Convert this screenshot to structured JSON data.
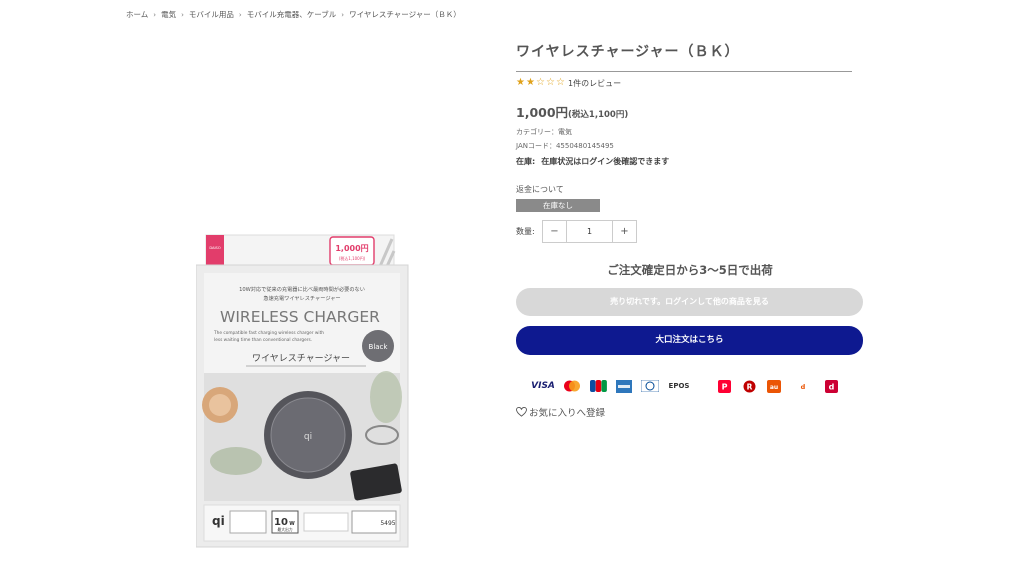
{
  "breadcrumb": [
    "ホーム",
    "電気",
    "モバイル用品",
    "モバイル充電器、ケーブル",
    "ワイヤレスチャージャー（ＢＫ）"
  ],
  "product": {
    "title": "ワイヤレスチャージャー（ＢＫ）",
    "rating_value": 2,
    "rating_max": 5,
    "review_text": "1件のレビュー",
    "price": "1,000円",
    "price_tax": "(税込1,100円)",
    "category": "カテゴリー：電気",
    "jan": "JANコード：4550480145495",
    "stock_label": "在庫:",
    "stock_value": "在庫状況はログイン後確認できます",
    "refund_link": "返金について",
    "soldout_badge": "在庫なし",
    "qty_label": "数量:",
    "qty_value": "1",
    "ship_note": "ご注文確定日から3〜5日で出荷",
    "soldout_button": "売り切れです。ログインして他の商品を見る",
    "bulk_button": "大口注文はこちら",
    "favorite": "お気に入りへ登録"
  },
  "package": {
    "brand": "DAISO",
    "price": "1,000円",
    "price_tax": "(税込1,100円)",
    "jp_line1": "10W対応で従来の充電器に比べ最両時間が必要のない",
    "jp_line2": "急速充電ワイヤレスチャージャー",
    "title": "WIRELESS CHARGER",
    "en_line1": "The compatible fast charging wireless charger with",
    "en_line2": "less waiting time than conventional chargers.",
    "color": "Black",
    "jp_name": "ワイヤレスチャージャー",
    "qi": "qi",
    "watt": "10",
    "watt_unit": "W",
    "watt_label": "最大出力",
    "code": "5495"
  },
  "payments": [
    {
      "name": "VISA",
      "color": "#1a1f71"
    },
    {
      "name": "mastercard",
      "color": "#eb001b"
    },
    {
      "name": "JCB",
      "color": "#0b4ea2"
    },
    {
      "name": "AMEX",
      "color": "#2e77bc"
    },
    {
      "name": "Diners",
      "color": "#004a97"
    },
    {
      "name": "EPOS",
      "color": "#333333"
    },
    {
      "name": "PayPay",
      "color": "#ff0033"
    },
    {
      "name": "楽天Pay",
      "color": "#bf0000"
    },
    {
      "name": "auPAY",
      "color": "#eb5505"
    },
    {
      "name": "d払い",
      "color": "#cc0033"
    }
  ],
  "colors": {
    "star": "#e0a21b",
    "bulk_button": "#0e1990",
    "soldout_badge": "#8a8a8a"
  }
}
